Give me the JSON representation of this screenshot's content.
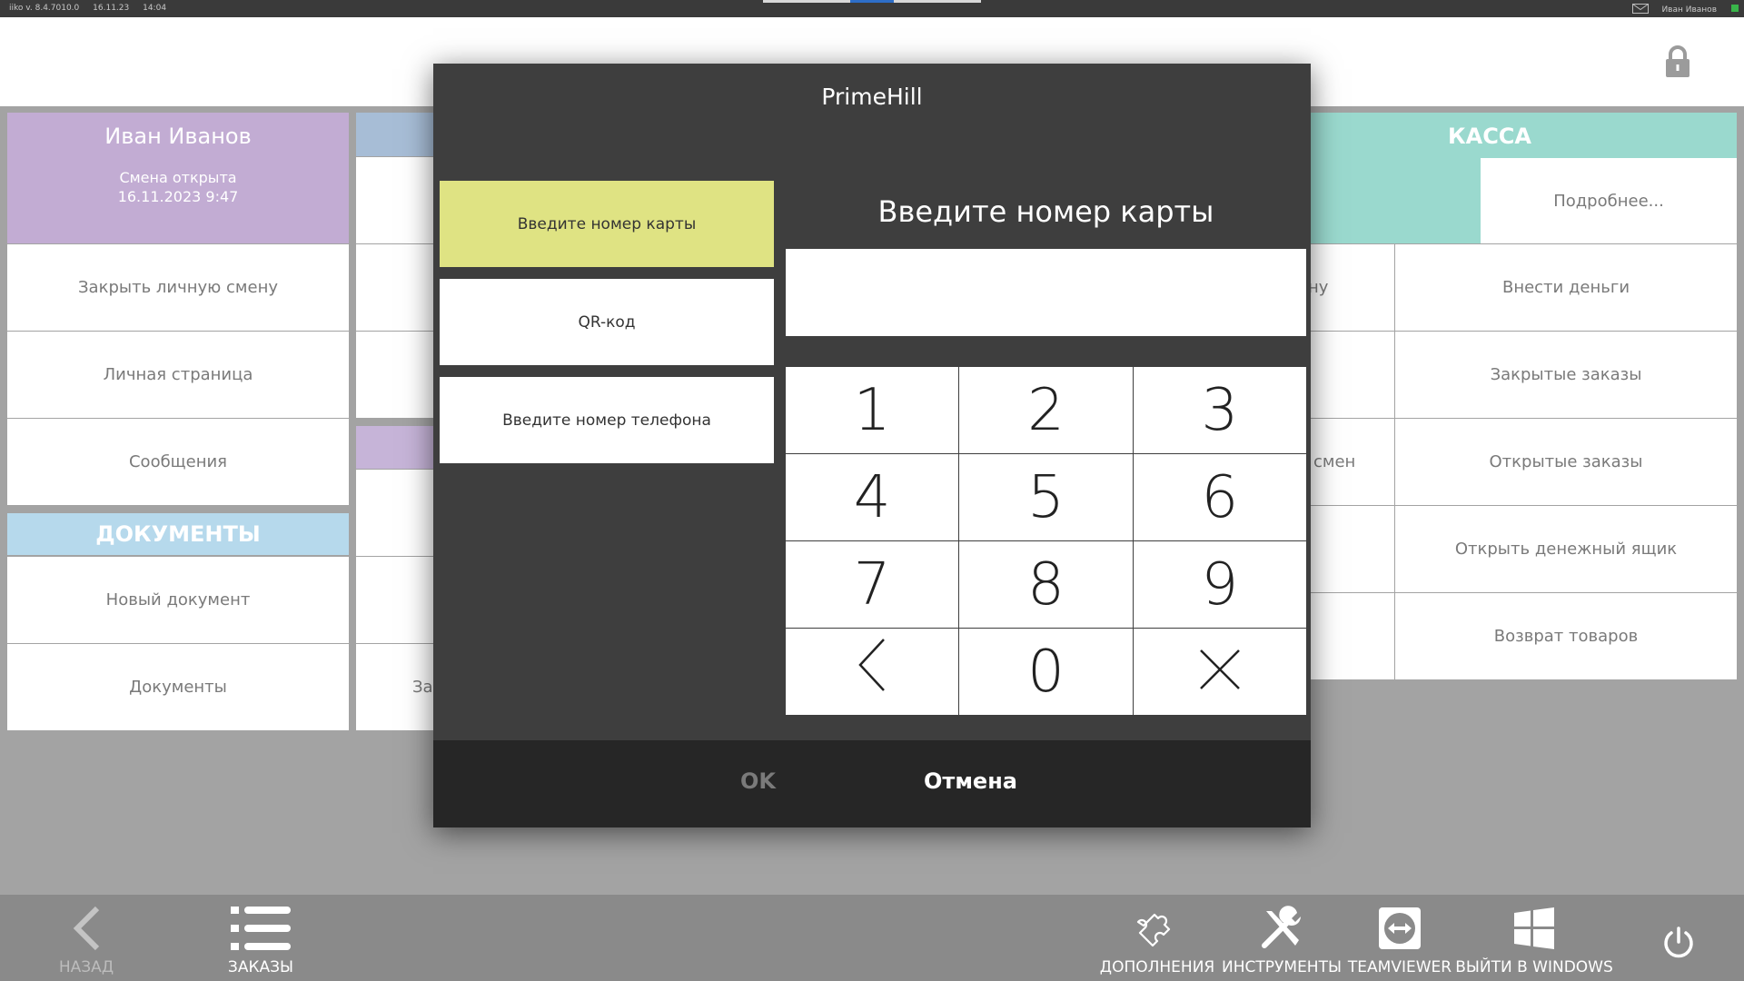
{
  "app": {
    "version": "iiko v. 8.4.7010.0",
    "date": "16.11.23",
    "time": "14:04",
    "user": "Иван Иванов",
    "accent": "#2d6ec8",
    "status_color": "#39b54a"
  },
  "profile": {
    "name": "Иван Иванов",
    "shift_status": "Смена открыта",
    "shift_datetime": "16.11.2023 9:47",
    "color": "#c2acd3",
    "items": [
      "Закрыть личную смену",
      "Личная страница",
      "Сообщения"
    ]
  },
  "documents": {
    "title": "ДОКУМЕНТЫ",
    "color": "#b6d9ec",
    "items": [
      "Новый документ",
      "Документы"
    ]
  },
  "middle": {
    "partial_label": "За",
    "head_color_1": "#a7bdd6",
    "head_color_2": "#c6b4d8"
  },
  "kassa": {
    "title": "КАССА",
    "color": "#9ad9ce",
    "more": "Подробнее...",
    "left_fragments": [
      "ну",
      "смен"
    ],
    "items": [
      "Внести деньги",
      "Закрытые заказы",
      "Открытые заказы",
      "Открыть денежный ящик",
      "Возврат товаров"
    ]
  },
  "modal": {
    "title": "PrimeHill",
    "options": [
      "Введите номер карты",
      "QR-код",
      "Введите номер телефона"
    ],
    "prompt": "Введите номер карты",
    "input_value": "",
    "keys": [
      "1",
      "2",
      "3",
      "4",
      "5",
      "6",
      "7",
      "8",
      "9",
      "backspace",
      "0",
      "clear"
    ],
    "ok": "OK",
    "cancel": "Отмена",
    "active_color": "#dfe383"
  },
  "toolbar": {
    "back": "НАЗАД",
    "orders": "ЗАКАЗЫ",
    "addons": "ДОПОЛНЕНИЯ",
    "tools": "ИНСТРУМЕНТЫ",
    "teamviewer": "TEAMVIEWER",
    "windows": "ВЫЙТИ В WINDOWS",
    "icons": [
      "chevron-left-icon",
      "list-icon",
      "puzzle-icon",
      "tools-icon",
      "teamviewer-icon",
      "windows-icon",
      "power-icon"
    ]
  }
}
